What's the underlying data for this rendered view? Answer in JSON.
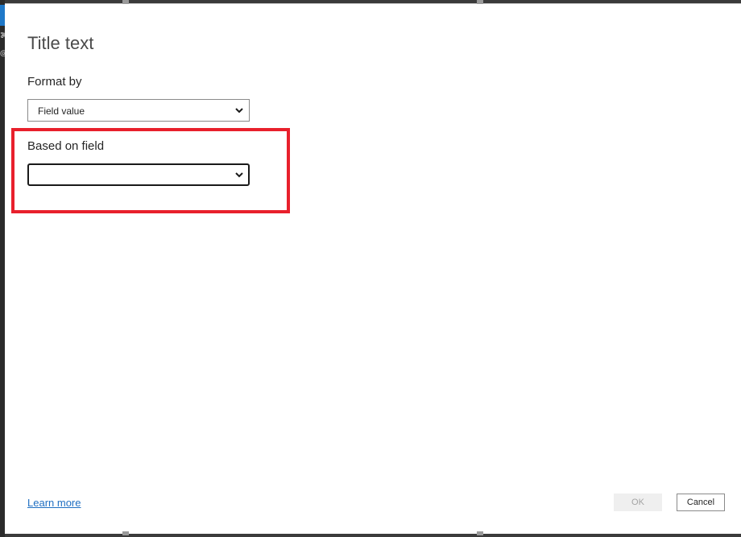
{
  "dialog": {
    "title": "Title text",
    "close_icon": "close-icon"
  },
  "format_by": {
    "label": "Format by",
    "selected": "Field value",
    "chevron_icon": "chevron-down-icon"
  },
  "based_on_field": {
    "label": "Based on field",
    "selected": "",
    "chevron_icon": "chevron-down-icon"
  },
  "footer": {
    "learn_more": "Learn more",
    "ok_label": "OK",
    "cancel_label": "Cancel"
  },
  "colors": {
    "highlight": "#e8202c",
    "link": "#1f6fc2",
    "accent_tab": "#1f78c8"
  }
}
